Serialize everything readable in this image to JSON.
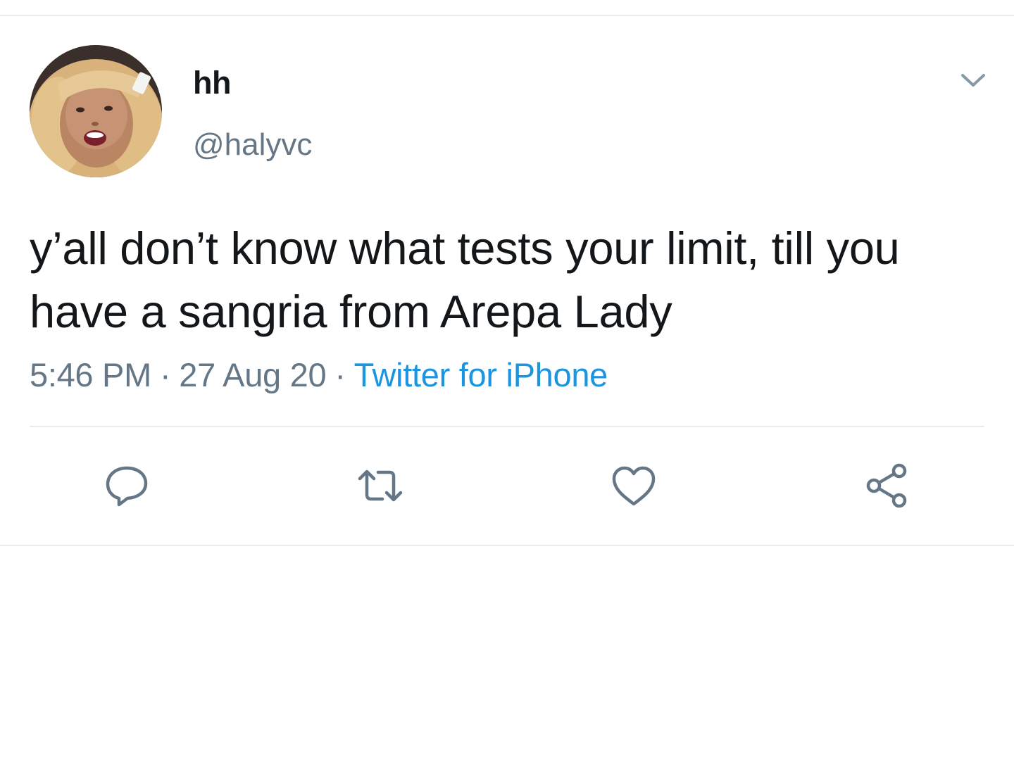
{
  "author": {
    "display_name": "hh",
    "handle": "@halyvc"
  },
  "tweet": {
    "text": "y’all don’t know what tests your limit, till you have a sangria from Arepa Lady",
    "time": "5:46 PM",
    "date": "27 Aug 20",
    "separator": "·",
    "source": "Twitter for iPhone"
  },
  "actions": {
    "reply_icon": "reply-icon",
    "retweet_icon": "retweet-icon",
    "like_icon": "heart-icon",
    "share_icon": "share-icon"
  },
  "colors": {
    "text": "#14171a",
    "secondary": "#657786",
    "link": "#1b95e0",
    "divider": "#e6ecf0",
    "icon": "#657786"
  }
}
